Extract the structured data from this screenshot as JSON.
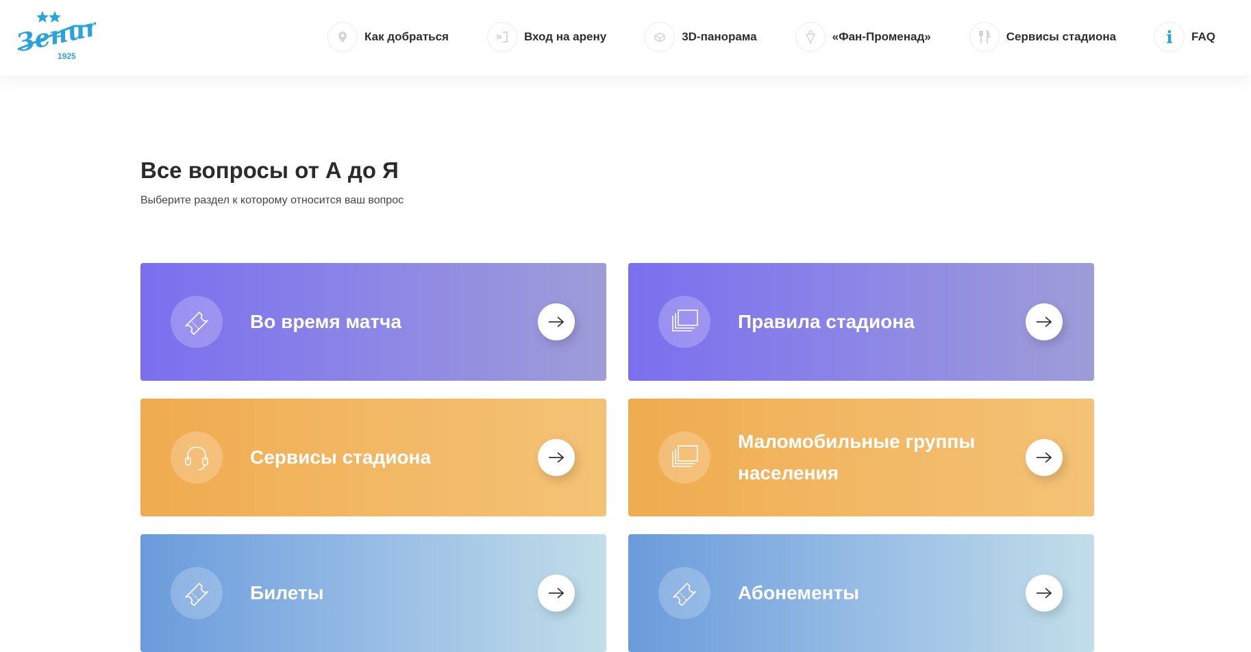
{
  "header": {
    "logo": {
      "wordmark": "Зенит",
      "year": "1925"
    },
    "nav": [
      {
        "label": "Как добраться",
        "icon": "location-pin-icon"
      },
      {
        "label": "Вход на арену",
        "icon": "entrance-icon"
      },
      {
        "label": "3D-панорама",
        "icon": "panorama-3d-icon"
      },
      {
        "label": "«Фан-Променад»",
        "icon": "fan-promenade-icon"
      },
      {
        "label": "Сервисы стадиона",
        "icon": "fork-knife-icon"
      },
      {
        "label": "FAQ",
        "icon": "info-icon",
        "glyph": "i"
      }
    ]
  },
  "main": {
    "title": "Все вопросы от А до Я",
    "subtitle": "Выберите раздел к которому относится ваш вопрос",
    "cards": [
      {
        "label": "Во время матча",
        "icon": "ticket-icon",
        "color": "purple"
      },
      {
        "label": "Правила стадиона",
        "icon": "pages-stack-icon",
        "color": "purple"
      },
      {
        "label": "Сервисы стадиона",
        "icon": "headset-icon",
        "color": "orange"
      },
      {
        "label": "Маломобильные группы населения",
        "icon": "pages-stack-icon",
        "color": "orange"
      },
      {
        "label": "Билеты",
        "icon": "ticket-icon",
        "color": "blue"
      },
      {
        "label": "Абонементы",
        "icon": "ticket-icon",
        "color": "blue"
      }
    ]
  },
  "colors": {
    "purple_start": "#7b6fef",
    "purple_end": "#9e9dd8",
    "orange_start": "#f0ab4f",
    "orange_end": "#f4c276",
    "blue_start": "#6a9bdb",
    "blue_end": "#c2dee9",
    "brand_blue": "#2aa3dd"
  }
}
